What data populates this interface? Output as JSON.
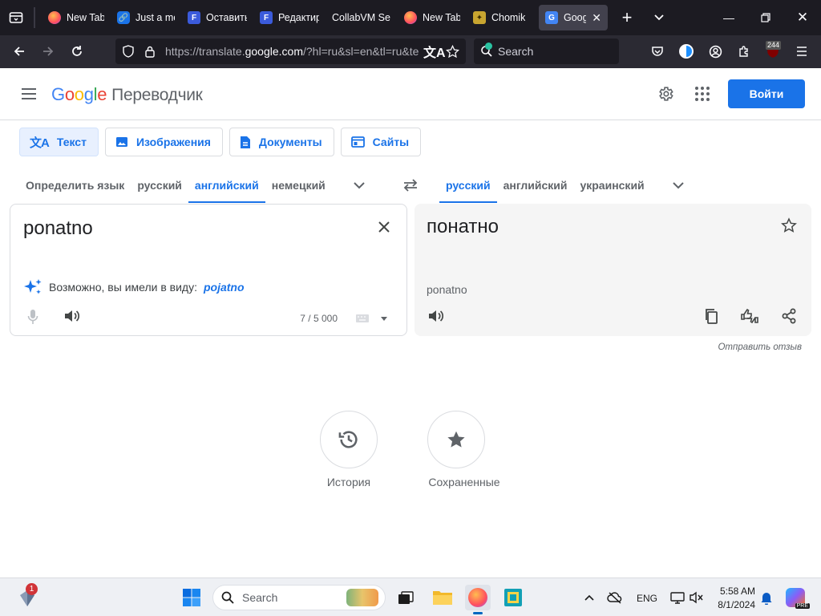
{
  "browser": {
    "tabs": [
      {
        "title": "New Tab",
        "favicon": "firefox-icon"
      },
      {
        "title": "Just a moment...",
        "favicon": "link-icon"
      },
      {
        "title": "Оставить",
        "favicon": "f-icon"
      },
      {
        "title": "Редактир",
        "favicon": "f-icon"
      },
      {
        "title": "CollabVM Se",
        "favicon": "none"
      },
      {
        "title": "New Tab",
        "favicon": "firefox-icon"
      },
      {
        "title": "Chomik",
        "favicon": "chomik-icon"
      },
      {
        "title": "Googl",
        "favicon": "google-translate-icon",
        "active": true
      }
    ],
    "url_prefix": "https://translate.",
    "url_domain": "google.com",
    "url_suffix": "/?hl=ru&sl=en&tl=ru&text=ponatno&op=translate",
    "search_placeholder": "Search",
    "badge_count": "244"
  },
  "header": {
    "logo_letters": [
      "G",
      "o",
      "o",
      "g",
      "l",
      "e"
    ],
    "logo_colors": [
      "#4285f4",
      "#ea4335",
      "#fbbc05",
      "#4285f4",
      "#34a853",
      "#ea4335"
    ],
    "product": "Переводчик",
    "signin": "Войти"
  },
  "modes": [
    {
      "label": "Текст",
      "icon": "translate-icon",
      "active": true
    },
    {
      "label": "Изображения",
      "icon": "image-icon"
    },
    {
      "label": "Документы",
      "icon": "document-icon"
    },
    {
      "label": "Сайты",
      "icon": "website-icon"
    }
  ],
  "source_langs": [
    {
      "label": "Определить язык"
    },
    {
      "label": "русский"
    },
    {
      "label": "английский",
      "active": true
    },
    {
      "label": "немецкий"
    }
  ],
  "target_langs": [
    {
      "label": "русский",
      "active": true
    },
    {
      "label": "английский"
    },
    {
      "label": "украинский"
    }
  ],
  "source": {
    "text": "ponatno",
    "did_you_mean_label": "Возможно, вы имели в виду:",
    "did_you_mean_suggestion": "pojatno",
    "counter": "7 / 5 000"
  },
  "target": {
    "text": "понатно",
    "transliteration": "ponatno"
  },
  "feedback": "Отправить отзыв",
  "bottom_actions": [
    {
      "label": "История",
      "icon": "history-icon"
    },
    {
      "label": "Сохраненные",
      "icon": "star-icon"
    }
  ],
  "taskbar": {
    "search_placeholder": "Search",
    "lang": "ENG",
    "time": "5:58 AM",
    "date": "8/1/2024",
    "notification_count": "1"
  },
  "colors": {
    "accent": "#1a73e8",
    "browser_dark": "#1c1b22"
  }
}
